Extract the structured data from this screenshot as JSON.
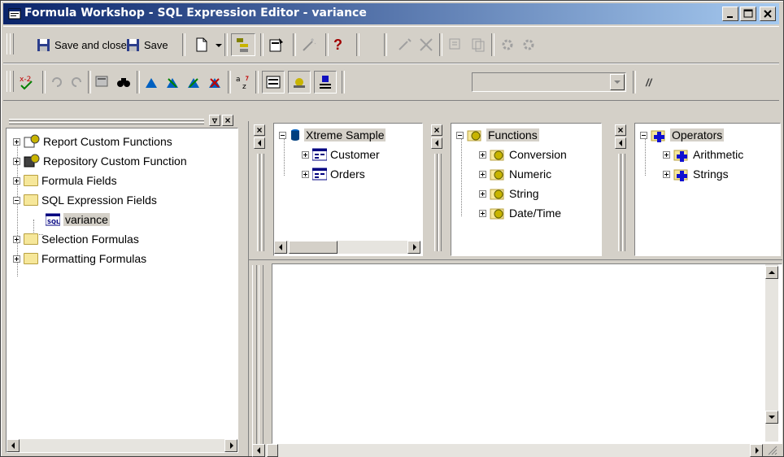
{
  "window": {
    "title": "Formula Workshop - SQL Expression Editor - variance"
  },
  "toolbar1": {
    "save_and_close": "Save and close",
    "save": "Save",
    "help": "?"
  },
  "toolbar2": {
    "comment": "//"
  },
  "left_tree": {
    "items": [
      {
        "label": "Report Custom Functions"
      },
      {
        "label": "Repository Custom Function"
      },
      {
        "label": "Formula Fields"
      },
      {
        "label": "SQL Expression Fields"
      },
      {
        "label": "variance"
      },
      {
        "label": "Selection Formulas"
      },
      {
        "label": "Formatting Formulas"
      }
    ]
  },
  "fields_tree": {
    "root": "Xtreme Sample",
    "items": [
      {
        "label": "Customer"
      },
      {
        "label": "Orders"
      }
    ]
  },
  "functions_tree": {
    "root": "Functions",
    "items": [
      {
        "label": "Conversion"
      },
      {
        "label": "Numeric"
      },
      {
        "label": "String"
      },
      {
        "label": "Date/Time"
      }
    ]
  },
  "operators_tree": {
    "root": "Operators",
    "items": [
      {
        "label": "Arithmetic"
      },
      {
        "label": "Strings"
      }
    ]
  },
  "editor": {
    "text": ""
  }
}
